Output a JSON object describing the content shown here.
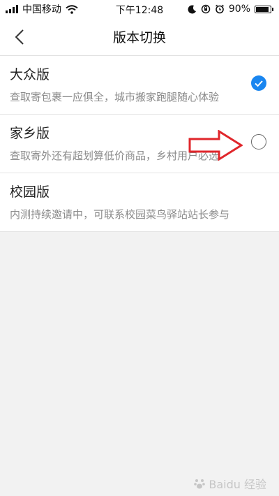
{
  "status": {
    "carrier": "中国移动",
    "time": "下午12:48",
    "battery": "90%",
    "battery_level": 0.9
  },
  "nav": {
    "title": "版本切换"
  },
  "options": [
    {
      "title": "大众版",
      "desc": "查取寄包裹一应俱全，城市搬家跑腿随心体验",
      "selected": true
    },
    {
      "title": "家乡版",
      "desc": "查取寄外还有超划算低价商品，乡村用户必选",
      "selected": false
    },
    {
      "title": "校园版",
      "desc": "内测持续邀请中，可联系校园菜鸟驿站站长参与",
      "selected": false
    }
  ],
  "colors": {
    "accent": "#1a86f0",
    "annotation": "#e0262b"
  },
  "watermark": "Baidu 经验"
}
